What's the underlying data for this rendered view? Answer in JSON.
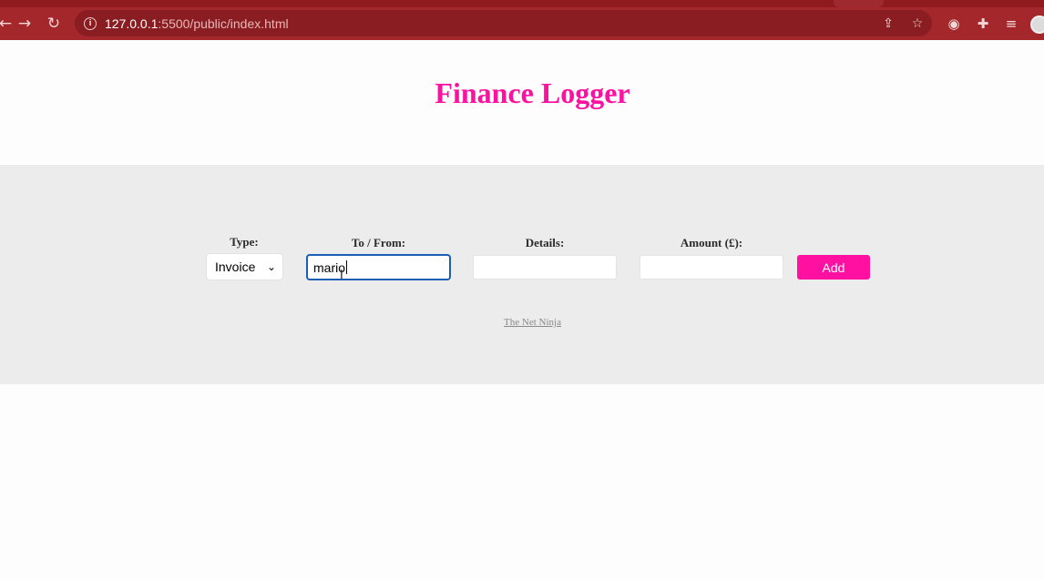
{
  "browser": {
    "url_host": "127.0.0.1",
    "url_path": ":5500/public/index.html",
    "icons": [
      "back-arrow-icon",
      "forward-arrow-icon",
      "reload-icon",
      "info-icon",
      "share-icon",
      "star-icon",
      "incognito-extension-icon",
      "puzzle-extension-icon",
      "media-queue-icon",
      "profile-avatar"
    ]
  },
  "page": {
    "title": "Finance Logger",
    "accent_color": "#ff10a0",
    "band_color": "#ececec"
  },
  "form": {
    "type_label": "Type:",
    "type_selected": "Invoice",
    "tofrom_label": "To / From:",
    "tofrom_value": "mario",
    "details_label": "Details:",
    "details_value": "",
    "amount_label": "Amount (£):",
    "amount_value": "",
    "add_label": "Add"
  },
  "footer": {
    "link_text": "The Net Ninja"
  }
}
